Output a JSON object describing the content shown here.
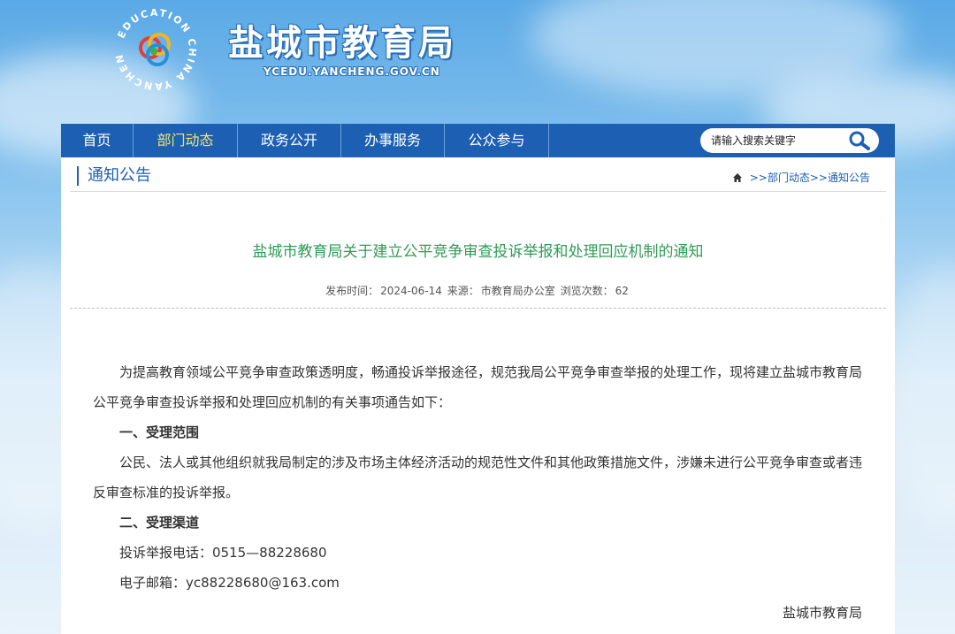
{
  "header": {
    "logo_ring_text": "EDUCATION CHINA YANCHENG",
    "title": "盐城市教育局",
    "domain": "YCEDU.YANCHENG.GOV.CN"
  },
  "nav": {
    "items": [
      {
        "label": "首页"
      },
      {
        "label": "部门动态"
      },
      {
        "label": "政务公开"
      },
      {
        "label": "办事服务"
      },
      {
        "label": "公众参与"
      }
    ],
    "active": "部门动态",
    "search_placeholder": "请输入搜索关键字"
  },
  "section": {
    "title": "通知公告",
    "breadcrumb": {
      "sep1": ">>",
      "crumb1": "部门动态",
      "sep2": ">>",
      "crumb2": "通知公告"
    }
  },
  "article": {
    "title": "盐城市教育局关于建立公平竞争审查投诉举报和处理回应机制的通知",
    "meta_date_label": "发布时间：",
    "meta_date": "2024-06-14",
    "meta_source_label": "来源：",
    "meta_source": "市教育局办公室",
    "meta_views_label": "浏览次数：",
    "meta_views": "62",
    "para1": "为提高教育领域公平竞争审查政策透明度，畅通投诉举报途径，规范我局公平竞争审查举报的处理工作，现将建立盐城市教育局公平竞争审查投诉举报和处理回应机制的有关事项通告如下：",
    "heading1": "一、受理范围",
    "para2": "公民、法人或其他组织就我局制定的涉及市场主体经济活动的规范性文件和其他政策措施文件，涉嫌未进行公平竞争审查或者违反审查标准的投诉举报。",
    "heading2": "二、受理渠道",
    "phone": "投诉举报电话：0515—88228680",
    "email": "电子邮箱：yc88228680@163.com",
    "signature": "盐城市教育局"
  },
  "colors": {
    "nav_bg": "#1d5fb3",
    "nav_active": "#f6e46a",
    "title_green": "#2f9c57",
    "link_blue": "#1d5fb3"
  }
}
